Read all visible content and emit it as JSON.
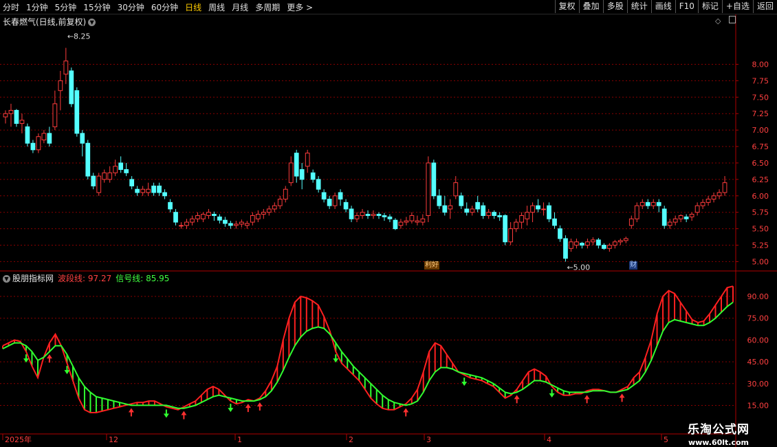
{
  "toolbar": {
    "periods": [
      "分时",
      "1分钟",
      "5分钟",
      "15分钟",
      "30分钟",
      "60分钟",
      "日线",
      "周线",
      "月线",
      "多周期",
      "更多 >"
    ],
    "active_index": 6,
    "right_buttons": [
      "复权",
      "叠加",
      "多股",
      "统计",
      "画线",
      "F10",
      "标记",
      "+自选",
      "返回"
    ]
  },
  "stock_title": "长春燃气(日线,前复权)",
  "indicator": {
    "name": "股朋指标网",
    "wave_label": "波段线: 97.27",
    "signal_label": "信号线: 85.95"
  },
  "annotations": {
    "high_label": "8.25",
    "low_label": "5.00",
    "news_tag": "利好",
    "finance_tag": "财"
  },
  "watermark": {
    "line1": "乐淘公式网",
    "line2": "www.60lt.com"
  },
  "colors": {
    "up": "#ff3c3c",
    "down": "#54ffff",
    "wave": "#ff2020",
    "signal": "#30ff30",
    "grid": "#8b0000"
  },
  "chart_data": [
    {
      "type": "candlestick",
      "ylim": [
        4.9,
        8.35
      ],
      "yticks": [
        "8.00",
        "7.75",
        "7.50",
        "7.25",
        "7.00",
        "6.75",
        "6.50",
        "6.25",
        "6.00",
        "5.75",
        "5.50",
        "5.25",
        "5.00"
      ],
      "candles": [
        [
          7.2,
          7.25,
          7.1,
          7.3
        ],
        [
          7.25,
          7.3,
          7.05,
          7.4
        ],
        [
          7.3,
          7.1,
          7.05,
          7.32
        ],
        [
          7.1,
          7.15,
          6.95,
          7.25
        ],
        [
          7.05,
          6.8,
          6.75,
          7.1
        ],
        [
          6.8,
          6.7,
          6.65,
          6.85
        ],
        [
          6.7,
          6.9,
          6.65,
          6.95
        ],
        [
          6.85,
          6.95,
          6.8,
          7.0
        ],
        [
          6.95,
          6.8,
          6.75,
          7.05
        ],
        [
          7.05,
          7.4,
          7.0,
          7.6
        ],
        [
          7.6,
          7.75,
          7.3,
          7.9
        ],
        [
          7.85,
          8.05,
          7.7,
          8.25
        ],
        [
          7.9,
          7.4,
          7.35,
          7.95
        ],
        [
          7.6,
          6.95,
          6.9,
          7.65
        ],
        [
          6.95,
          6.8,
          6.6,
          7.0
        ],
        [
          6.8,
          6.3,
          6.25,
          6.85
        ],
        [
          6.3,
          6.15,
          6.1,
          6.35
        ],
        [
          6.05,
          6.3,
          6.0,
          6.35
        ],
        [
          6.25,
          6.35,
          6.2,
          6.4
        ],
        [
          6.25,
          6.35,
          6.2,
          6.45
        ],
        [
          6.35,
          6.45,
          6.3,
          6.55
        ],
        [
          6.5,
          6.4,
          6.35,
          6.6
        ],
        [
          6.4,
          6.35,
          6.3,
          6.5
        ],
        [
          6.25,
          6.15,
          6.1,
          6.3
        ],
        [
          6.1,
          6.05,
          6.0,
          6.15
        ],
        [
          6.05,
          6.1,
          6.0,
          6.15
        ],
        [
          6.05,
          6.1,
          6.0,
          6.2
        ],
        [
          6.15,
          6.05,
          6.0,
          6.2
        ],
        [
          6.15,
          6.05,
          6.0,
          6.2
        ],
        [
          6.05,
          6.0,
          5.95,
          6.1
        ],
        [
          5.9,
          5.8,
          5.75,
          5.95
        ],
        [
          5.75,
          5.6,
          5.55,
          5.8
        ],
        [
          5.55,
          5.55,
          5.5,
          5.6
        ],
        [
          5.55,
          5.6,
          5.5,
          5.65
        ],
        [
          5.6,
          5.65,
          5.55,
          5.7
        ],
        [
          5.65,
          5.7,
          5.6,
          5.75
        ],
        [
          5.65,
          5.72,
          5.6,
          5.75
        ],
        [
          5.7,
          5.75,
          5.65,
          5.8
        ],
        [
          5.72,
          5.7,
          5.62,
          5.76
        ],
        [
          5.68,
          5.63,
          5.58,
          5.72
        ],
        [
          5.63,
          5.58,
          5.53,
          5.68
        ],
        [
          5.58,
          5.55,
          5.5,
          5.62
        ],
        [
          5.55,
          5.57,
          5.5,
          5.62
        ],
        [
          5.57,
          5.6,
          5.52,
          5.64
        ],
        [
          5.55,
          5.58,
          5.5,
          5.62
        ],
        [
          5.6,
          5.7,
          5.55,
          5.75
        ],
        [
          5.65,
          5.72,
          5.6,
          5.78
        ],
        [
          5.72,
          5.75,
          5.65,
          5.8
        ],
        [
          5.75,
          5.8,
          5.7,
          5.85
        ],
        [
          5.8,
          5.85,
          5.75,
          5.9
        ],
        [
          5.85,
          5.95,
          5.8,
          6.0
        ],
        [
          5.95,
          6.1,
          5.9,
          6.15
        ],
        [
          6.2,
          6.5,
          6.15,
          6.6
        ],
        [
          6.65,
          6.3,
          6.2,
          6.7
        ],
        [
          6.4,
          6.25,
          6.1,
          6.5
        ],
        [
          6.45,
          6.65,
          6.35,
          6.7
        ],
        [
          6.35,
          6.25,
          6.2,
          6.4
        ],
        [
          6.25,
          6.1,
          6.05,
          6.3
        ],
        [
          6.05,
          5.95,
          5.9,
          6.1
        ],
        [
          5.95,
          5.85,
          5.8,
          6.0
        ],
        [
          5.85,
          6.0,
          5.8,
          6.05
        ],
        [
          6.05,
          5.95,
          5.85,
          6.1
        ],
        [
          5.9,
          5.8,
          5.75,
          5.95
        ],
        [
          5.8,
          5.65,
          5.6,
          5.85
        ],
        [
          5.65,
          5.7,
          5.6,
          5.75
        ],
        [
          5.7,
          5.75,
          5.65,
          5.8
        ],
        [
          5.72,
          5.7,
          5.65,
          5.78
        ],
        [
          5.7,
          5.72,
          5.65,
          5.78
        ],
        [
          5.72,
          5.7,
          5.65,
          5.75
        ],
        [
          5.7,
          5.68,
          5.62,
          5.74
        ],
        [
          5.68,
          5.65,
          5.6,
          5.72
        ],
        [
          5.63,
          5.5,
          5.48,
          5.66
        ],
        [
          5.55,
          5.6,
          5.5,
          5.65
        ],
        [
          5.6,
          5.62,
          5.55,
          5.68
        ],
        [
          5.62,
          5.7,
          5.58,
          5.75
        ],
        [
          5.6,
          5.62,
          5.55,
          5.7
        ],
        [
          5.6,
          5.65,
          5.55,
          5.72
        ],
        [
          5.7,
          6.5,
          5.6,
          6.6
        ],
        [
          6.5,
          6.0,
          5.95,
          6.55
        ],
        [
          6.0,
          5.85,
          5.8,
          6.1
        ],
        [
          5.85,
          5.75,
          5.7,
          6.0
        ],
        [
          5.8,
          5.85,
          5.65,
          5.95
        ],
        [
          6.0,
          6.2,
          5.95,
          6.3
        ],
        [
          6.0,
          5.85,
          5.8,
          6.05
        ],
        [
          5.8,
          5.75,
          5.7,
          5.9
        ],
        [
          5.75,
          5.8,
          5.7,
          5.85
        ],
        [
          5.9,
          5.8,
          5.75,
          6.0
        ],
        [
          5.85,
          5.7,
          5.65,
          5.9
        ],
        [
          5.7,
          5.75,
          5.65,
          5.8
        ],
        [
          5.75,
          5.7,
          5.65,
          5.78
        ],
        [
          5.7,
          5.68,
          5.62,
          5.75
        ],
        [
          5.7,
          5.3,
          5.25,
          5.72
        ],
        [
          5.3,
          5.5,
          5.25,
          5.6
        ],
        [
          5.5,
          5.6,
          5.45,
          5.65
        ],
        [
          5.6,
          5.7,
          5.5,
          5.75
        ],
        [
          5.65,
          5.75,
          5.55,
          5.85
        ],
        [
          5.75,
          5.85,
          5.6,
          5.9
        ],
        [
          5.85,
          5.8,
          5.75,
          5.95
        ],
        [
          5.8,
          5.8,
          5.7,
          5.9
        ],
        [
          5.85,
          5.65,
          5.6,
          5.9
        ],
        [
          5.65,
          5.55,
          5.5,
          5.75
        ],
        [
          5.5,
          5.35,
          5.3,
          5.55
        ],
        [
          5.35,
          5.05,
          5.0,
          5.4
        ],
        [
          5.2,
          5.3,
          5.15,
          5.35
        ],
        [
          5.25,
          5.3,
          5.2,
          5.35
        ],
        [
          5.28,
          5.25,
          5.2,
          5.3
        ],
        [
          5.25,
          5.3,
          5.2,
          5.35
        ],
        [
          5.3,
          5.33,
          5.25,
          5.37
        ],
        [
          5.33,
          5.25,
          5.2,
          5.36
        ],
        [
          5.25,
          5.2,
          5.18,
          5.28
        ],
        [
          5.2,
          5.25,
          5.15,
          5.28
        ],
        [
          5.25,
          5.3,
          5.2,
          5.33
        ],
        [
          5.3,
          5.32,
          5.25,
          5.35
        ],
        [
          5.32,
          5.35,
          5.28,
          5.38
        ],
        [
          5.55,
          5.65,
          5.5,
          5.7
        ],
        [
          5.65,
          5.85,
          5.6,
          5.9
        ],
        [
          5.85,
          5.9,
          5.8,
          5.95
        ],
        [
          5.9,
          5.85,
          5.8,
          5.95
        ],
        [
          5.85,
          5.9,
          5.8,
          5.95
        ],
        [
          5.9,
          5.85,
          5.75,
          5.95
        ],
        [
          5.8,
          5.55,
          5.5,
          5.85
        ],
        [
          5.55,
          5.6,
          5.5,
          5.65
        ],
        [
          5.6,
          5.65,
          5.55,
          5.7
        ],
        [
          5.65,
          5.7,
          5.6,
          5.72
        ],
        [
          5.68,
          5.65,
          5.6,
          5.72
        ],
        [
          5.68,
          5.72,
          5.62,
          5.75
        ],
        [
          5.75,
          5.85,
          5.7,
          5.9
        ],
        [
          5.85,
          5.9,
          5.8,
          5.95
        ],
        [
          5.9,
          5.95,
          5.85,
          6.0
        ],
        [
          5.95,
          6.0,
          5.9,
          6.05
        ],
        [
          6.0,
          6.05,
          5.95,
          6.1
        ],
        [
          6.05,
          6.2,
          6.0,
          6.3
        ]
      ]
    },
    {
      "type": "line",
      "ylim": [
        10,
        99
      ],
      "yticks": [
        "90.00",
        "75.00",
        "60.00",
        "45.00",
        "30.00",
        "15.00"
      ],
      "x_labels": [
        "2025年",
        "12",
        "1",
        "2",
        "3",
        "4",
        "5"
      ],
      "series": [
        {
          "name": "波段线",
          "values": [
            56,
            58,
            60,
            59,
            52,
            42,
            34,
            48,
            58,
            64,
            56,
            44,
            32,
            20,
            12,
            10,
            10,
            11,
            12,
            13,
            14,
            15,
            16,
            17,
            17,
            18,
            18,
            16,
            14,
            13,
            12,
            14,
            16,
            18,
            22,
            26,
            28,
            26,
            22,
            18,
            16,
            17,
            19,
            18,
            20,
            25,
            32,
            42,
            60,
            75,
            86,
            90,
            89,
            87,
            84,
            76,
            66,
            52,
            44,
            40,
            36,
            32,
            26,
            20,
            16,
            13,
            12,
            12,
            14,
            16,
            20,
            26,
            38,
            52,
            58,
            56,
            50,
            44,
            38,
            36,
            34,
            33,
            32,
            30,
            28,
            24,
            20,
            22,
            26,
            32,
            38,
            40,
            38,
            35,
            28,
            24,
            22,
            22,
            23,
            23,
            25,
            26,
            26,
            25,
            24,
            24,
            26,
            28,
            34,
            38,
            48,
            60,
            78,
            90,
            94,
            92,
            86,
            80,
            74,
            72,
            73,
            78,
            84,
            90,
            96,
            97
          ]
        },
        {
          "name": "信号线",
          "values": [
            54,
            56,
            58,
            58,
            56,
            52,
            46,
            48,
            52,
            56,
            56,
            50,
            42,
            34,
            28,
            24,
            21,
            20,
            19,
            18,
            17,
            16,
            15,
            15,
            15,
            15,
            15,
            15,
            15,
            14,
            13,
            13,
            14,
            15,
            17,
            19,
            21,
            22,
            21,
            20,
            19,
            18,
            18,
            18,
            19,
            21,
            25,
            31,
            39,
            48,
            56,
            62,
            66,
            68,
            69,
            68,
            64,
            58,
            52,
            47,
            42,
            38,
            34,
            30,
            26,
            22,
            19,
            17,
            16,
            15,
            16,
            18,
            24,
            32,
            38,
            41,
            41,
            40,
            38,
            37,
            36,
            35,
            34,
            32,
            30,
            27,
            24,
            23,
            24,
            26,
            29,
            32,
            32,
            31,
            29,
            27,
            25,
            24,
            24,
            24,
            24,
            25,
            25,
            25,
            24,
            24,
            25,
            26,
            29,
            32,
            38,
            46,
            56,
            66,
            72,
            74,
            73,
            72,
            71,
            70,
            70,
            72,
            75,
            79,
            83,
            86
          ]
        }
      ]
    }
  ]
}
